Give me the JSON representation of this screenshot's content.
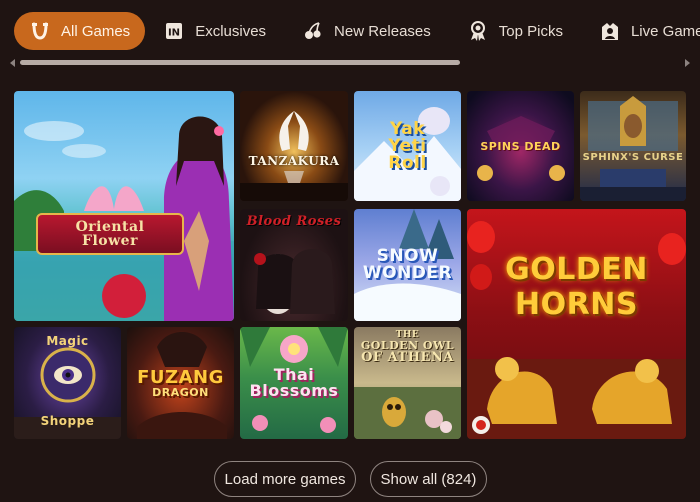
{
  "tabs": [
    {
      "label": "All Games",
      "icon": "horseshoe-icon",
      "active": true
    },
    {
      "label": "Exclusives",
      "icon": "exclusive-badge-icon",
      "active": false
    },
    {
      "label": "New Releases",
      "icon": "cherries-icon",
      "active": false
    },
    {
      "label": "Top Picks",
      "icon": "award-ribbon-icon",
      "active": false
    },
    {
      "label": "Live Games",
      "icon": "live-dealer-icon",
      "active": false
    }
  ],
  "scroll": {
    "position": 0.0
  },
  "games": {
    "oriental_flower": {
      "line1": "Oriental",
      "line2": "Flower"
    },
    "tanzakura": {
      "title": "TANZAKURA"
    },
    "yak_yeti_roll": {
      "line1": "Yak",
      "line2": "Yeti",
      "line3": "Roll"
    },
    "spins_of_the_dead": {
      "title": "SPINS DEAD"
    },
    "sphinxs_curse": {
      "title": "SPHINX'S CURSE"
    },
    "blood_and_roses": {
      "title": "Blood Roses"
    },
    "snow_wonder": {
      "line1": "SNOW",
      "line2": "WONDER"
    },
    "golden_horns": {
      "line1": "GOLDEN",
      "line2": "HORNS"
    },
    "magic_shoppe": {
      "line1": "Magic",
      "line2": "Shoppe"
    },
    "fuzang_dragon": {
      "line1": "FUZANG",
      "line2": "DRAGON"
    },
    "thai_blossoms": {
      "line1": "Thai",
      "line2": "Blossoms"
    },
    "golden_owl_athena": {
      "line1": "THE",
      "line2": "GOLDEN OWL",
      "line3": "OF ATHENA"
    }
  },
  "buttons": {
    "load_more": "Load more games",
    "show_all": "Show all (824)"
  },
  "colors": {
    "background": "#1f1412",
    "accent": "#c8681d",
    "button_border": "#8f8480"
  }
}
